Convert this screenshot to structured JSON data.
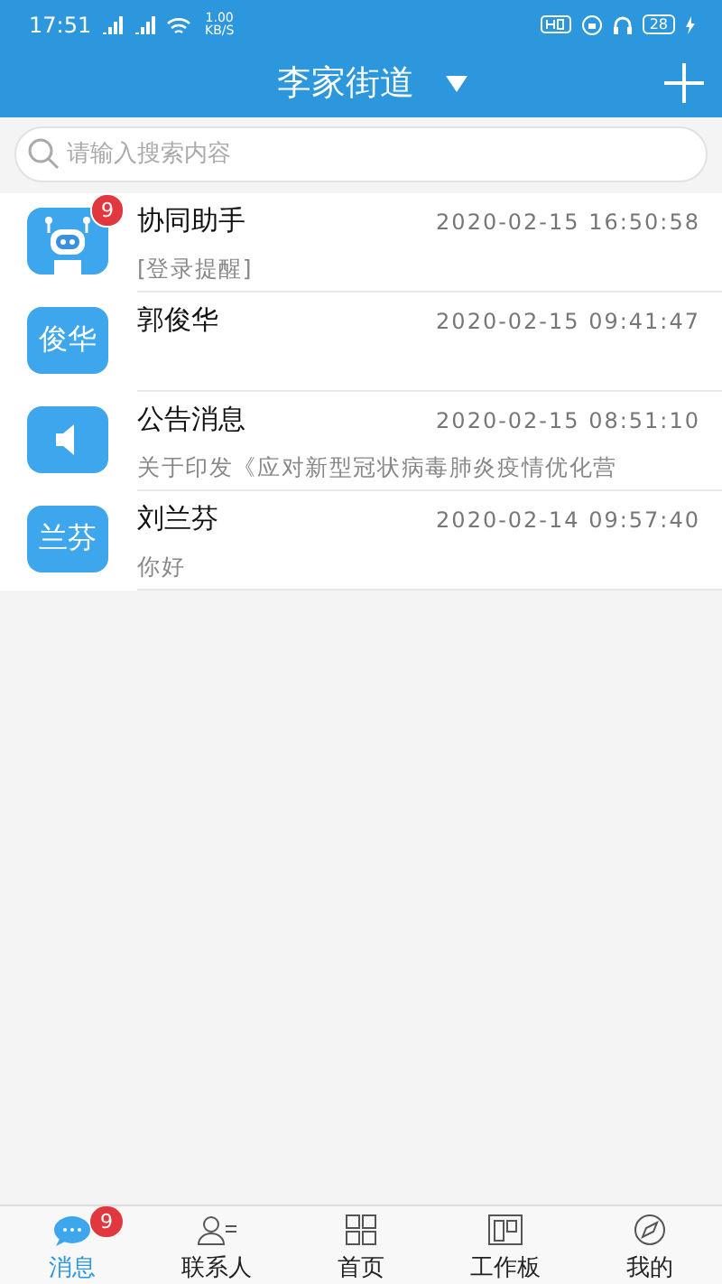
{
  "status_bar": {
    "time": "17:51",
    "speed": "1.00 KB/S",
    "battery": "28"
  },
  "header": {
    "title": "李家街道"
  },
  "search": {
    "placeholder": "请输入搜索内容"
  },
  "conversations": [
    {
      "avatar": {
        "kind": "robot"
      },
      "name": "协同助手",
      "time": "2020-02-15  16:50:58",
      "preview": "[登录提醒]",
      "badge": "9"
    },
    {
      "avatar": {
        "kind": "text",
        "text": "俊华"
      },
      "name": "郭俊华",
      "time": "2020-02-15  09:41:47"
    },
    {
      "avatar": {
        "kind": "speaker"
      },
      "name": "公告消息",
      "time": "2020-02-15  08:51:10",
      "preview": "关于印发《应对新型冠状病毒肺炎疫情优化营"
    },
    {
      "avatar": {
        "kind": "text",
        "text": "兰芬"
      },
      "name": "刘兰芬",
      "time": "2020-02-14  09:57:40",
      "preview": "你好"
    }
  ],
  "tab_bar": [
    {
      "kind": "chat",
      "label": "消息",
      "selected": true,
      "badge": "9"
    },
    {
      "kind": "contacts",
      "label": "联系人",
      "selected": false
    },
    {
      "kind": "grid",
      "label": "首页",
      "selected": false
    },
    {
      "kind": "board",
      "label": "工作板",
      "selected": false
    },
    {
      "kind": "compass",
      "label": "我的",
      "selected": false
    }
  ]
}
